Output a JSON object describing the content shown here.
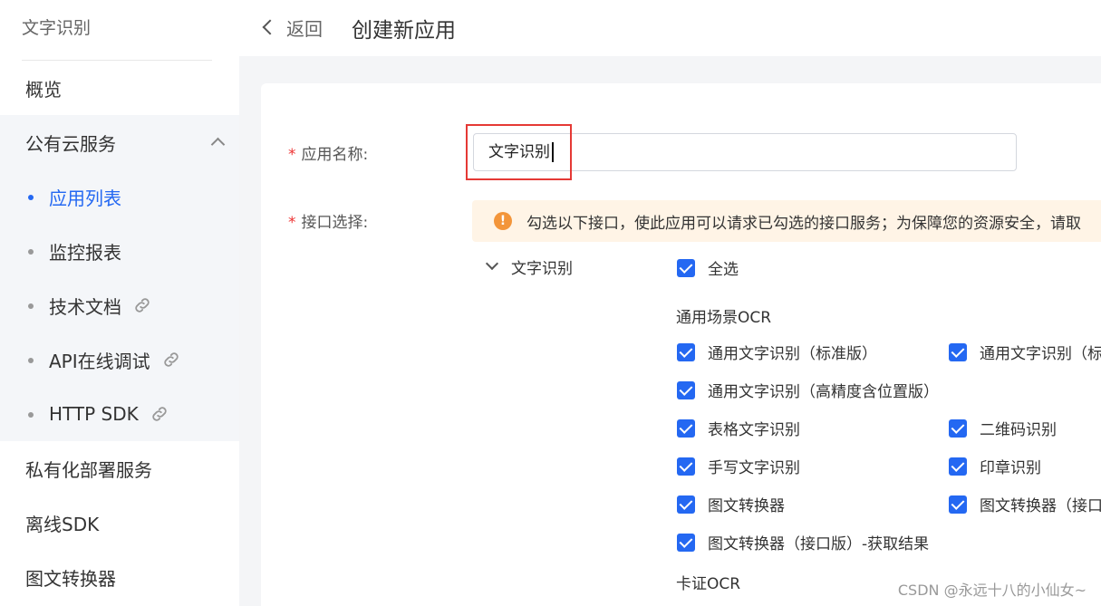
{
  "sidebar": {
    "title": "文字识别",
    "items": [
      {
        "label": "概览"
      },
      {
        "label": "公有云服务"
      },
      {
        "label": "私有化部署服务"
      },
      {
        "label": "离线SDK"
      },
      {
        "label": "图文转换器"
      }
    ],
    "sub_items": [
      {
        "label": "应用列表",
        "active": true
      },
      {
        "label": "监控报表"
      },
      {
        "label": "技术文档",
        "icon": "link-icon"
      },
      {
        "label": "API在线调试",
        "icon": "link-icon"
      },
      {
        "label": "HTTP SDK",
        "icon": "link-icon"
      }
    ]
  },
  "header": {
    "back_label": "返回",
    "title": "创建新应用"
  },
  "form": {
    "name_label": "应用名称:",
    "name_value": "文字识别",
    "api_label": "接口选择:",
    "notice": "勾选以下接口，使此应用可以请求已勾选的接口服务；为保障您的资源安全，请取",
    "tree_label": "文字识别",
    "select_all": "全选",
    "section_general": "通用场景OCR",
    "section_card": "卡证OCR",
    "checkboxes": [
      "通用文字识别（标准版）",
      "通用文字识别（标",
      "通用文字识别（高精度含位置版）",
      "表格文字识别",
      "二维码识别",
      "手写文字识别",
      "印章识别",
      "图文转换器",
      "图文转换器（接口",
      "图文转换器（接口版）-获取结果"
    ]
  },
  "watermark": "CSDN @永远十八的小仙女~",
  "colors": {
    "accent": "#2468f2",
    "required": "#e33333",
    "warning": "#f3953a",
    "highlight": "#e53935"
  }
}
